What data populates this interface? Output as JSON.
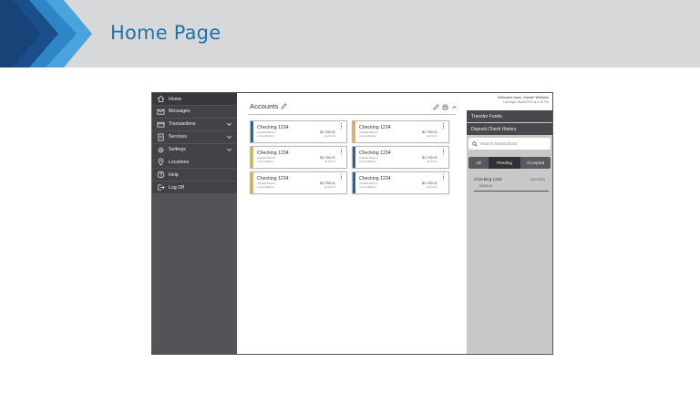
{
  "slide": {
    "title": "Home Page"
  },
  "colors": {
    "banner_bg": "#d7d8da",
    "title": "#1f72a8",
    "chevron_dark": "#1a4e8a",
    "chevron_light": "#2e86c6",
    "sidebar": "#55535a",
    "stripe_blue": "#2b62a6",
    "stripe_yellow": "#e5b52a"
  },
  "sidebar": {
    "items": [
      {
        "label": "Home",
        "icon": "home-icon"
      },
      {
        "label": "Messages",
        "icon": "envelope-icon"
      },
      {
        "label": "Transactions",
        "icon": "card-icon",
        "expandable": true
      },
      {
        "label": "Services",
        "icon": "document-icon",
        "expandable": true
      },
      {
        "label": "Settings",
        "icon": "gear-icon",
        "expandable": true
      },
      {
        "label": "Locations",
        "icon": "location-pin-icon"
      },
      {
        "label": "Help",
        "icon": "help-icon"
      },
      {
        "label": "Log Off",
        "icon": "logout-icon"
      }
    ]
  },
  "accounts": {
    "title": "Accounts",
    "cards": [
      {
        "name": "Checking 1234",
        "available_label": "Available Balance",
        "current_label": "Current Balance",
        "available": "$1,750.21",
        "current": "$2,616.21",
        "stripe": "blue"
      },
      {
        "name": "Checking 1234",
        "available_label": "Available Balance",
        "current_label": "Current Balance",
        "available": "$1,750.21",
        "current": "$2,616.21",
        "stripe": "yellow"
      },
      {
        "name": "Checking 1234",
        "available_label": "Available Balance",
        "current_label": "Current Balance",
        "available": "$1,750.21",
        "current": "$2,616.21",
        "stripe": "yellow"
      },
      {
        "name": "Checking 1234",
        "available_label": "Available Balance",
        "current_label": "Current Balance",
        "available": "$1,750.21",
        "current": "$2,616.21",
        "stripe": "blue"
      },
      {
        "name": "Checking 1234",
        "available_label": "Available Balance",
        "current_label": "Current Balance",
        "available": "$1,750.21",
        "current": "$2,616.21",
        "stripe": "yellow"
      },
      {
        "name": "Checking 1234",
        "available_label": "Available Balance",
        "current_label": "Current Balance",
        "available": "$1,750.21",
        "current": "$2,616.21",
        "stripe": "blue"
      }
    ]
  },
  "right_panel": {
    "welcome": "Welcome back, Xander Williams",
    "last_login": "Last login 05/15/2019 at 4:15 PM",
    "transfer_funds": "Transfer Funds",
    "deposit_history": "Deposit Check History",
    "search_placeholder": "Search transactions",
    "segments": [
      "All",
      "Pending",
      "Accepted"
    ],
    "pending": {
      "name": "Checking 1234",
      "amount": "$1000.00",
      "ref": "XXXX0110"
    }
  }
}
